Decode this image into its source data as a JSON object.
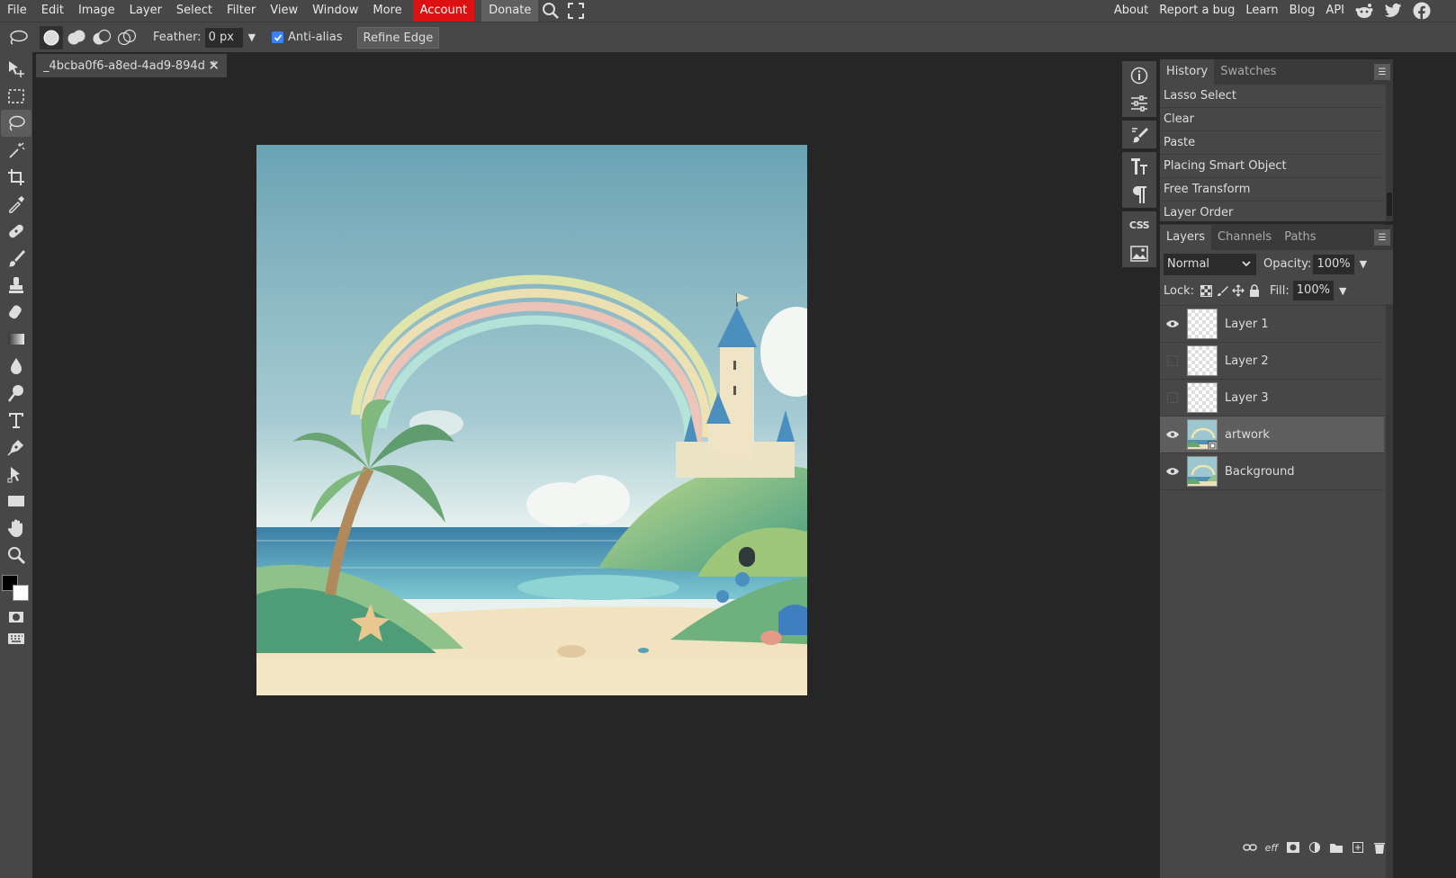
{
  "menubar": {
    "items": [
      "File",
      "Edit",
      "Image",
      "Layer",
      "Select",
      "Filter",
      "View",
      "Window",
      "More"
    ],
    "account": "Account",
    "donate": "Donate",
    "right": [
      "About",
      "Report a bug",
      "Learn",
      "Blog",
      "API"
    ],
    "accent_color": "#dd1111"
  },
  "options": {
    "feather_label": "Feather:",
    "feather_value": "0 px",
    "antialias_label": "Anti-alias",
    "antialias_checked": true,
    "refine_edge": "Refine Edge"
  },
  "document": {
    "tab_title": "_4bcba0f6-a8ed-4ad9-894d",
    "modified_marker": "*"
  },
  "history": {
    "tabs": [
      "History",
      "Swatches"
    ],
    "items": [
      "Lasso Select",
      "Clear",
      "Paste",
      "Placing Smart Object",
      "Free Transform",
      "Layer Order"
    ]
  },
  "layers": {
    "tabs": [
      "Layers",
      "Channels",
      "Paths"
    ],
    "blend_mode": "Normal",
    "opacity_label": "Opacity:",
    "opacity_value": "100%",
    "lock_label": "Lock:",
    "fill_label": "Fill:",
    "fill_value": "100%",
    "items": [
      {
        "name": "Layer 1",
        "visible": true,
        "selected": false
      },
      {
        "name": "Layer 2",
        "visible": false,
        "selected": false
      },
      {
        "name": "Layer 3",
        "visible": false,
        "selected": false
      },
      {
        "name": "artwork",
        "visible": true,
        "selected": true
      },
      {
        "name": "Background",
        "visible": true,
        "selected": false
      }
    ]
  },
  "side_icons": {
    "css_label": "CSS"
  }
}
